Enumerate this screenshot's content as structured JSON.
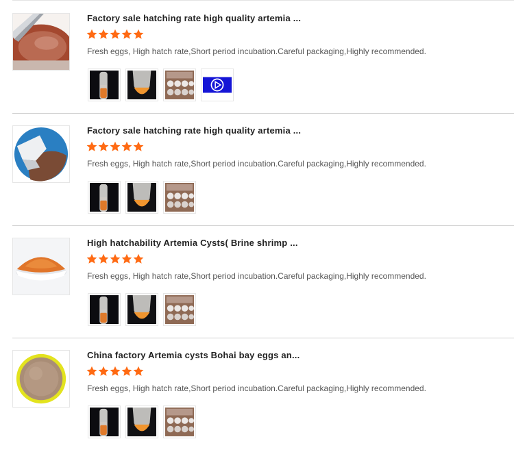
{
  "accent_star_color": "#ff6a13",
  "reviews": [
    {
      "title": "Factory sale hatching rate high quality artemia ...",
      "rating": 5,
      "text": "Fresh eggs, High hatch rate,Short period incubation.Careful packaging,Highly recommended.",
      "thumb_icon": "artemia-jar-thumb",
      "photos": [
        "tube-photo",
        "cone-tube-photo",
        "tray-photo",
        "video-thumbnail"
      ]
    },
    {
      "title": "Factory sale hatching rate high quality artemia ...",
      "rating": 5,
      "text": "Fresh eggs, High hatch rate,Short period incubation.Careful packaging,Highly recommended.",
      "thumb_icon": "artemia-pour-thumb",
      "photos": [
        "tube-photo",
        "cone-tube-photo",
        "tray-photo"
      ]
    },
    {
      "title": "High hatchability Artemia Cysts( Brine shrimp ...",
      "rating": 5,
      "text": "Fresh eggs, High hatch rate,Short period incubation.Careful packaging,Highly recommended.",
      "thumb_icon": "artemia-powder-thumb",
      "photos": [
        "tube-photo",
        "cone-tube-photo",
        "tray-photo"
      ]
    },
    {
      "title": "China factory Artemia cysts Bohai bay eggs an...",
      "rating": 5,
      "text": "Fresh eggs, High hatch rate,Short period incubation.Careful packaging,Highly recommended.",
      "thumb_icon": "artemia-dish-thumb",
      "photos": [
        "tube-photo",
        "cone-tube-photo",
        "tray-photo"
      ]
    }
  ]
}
